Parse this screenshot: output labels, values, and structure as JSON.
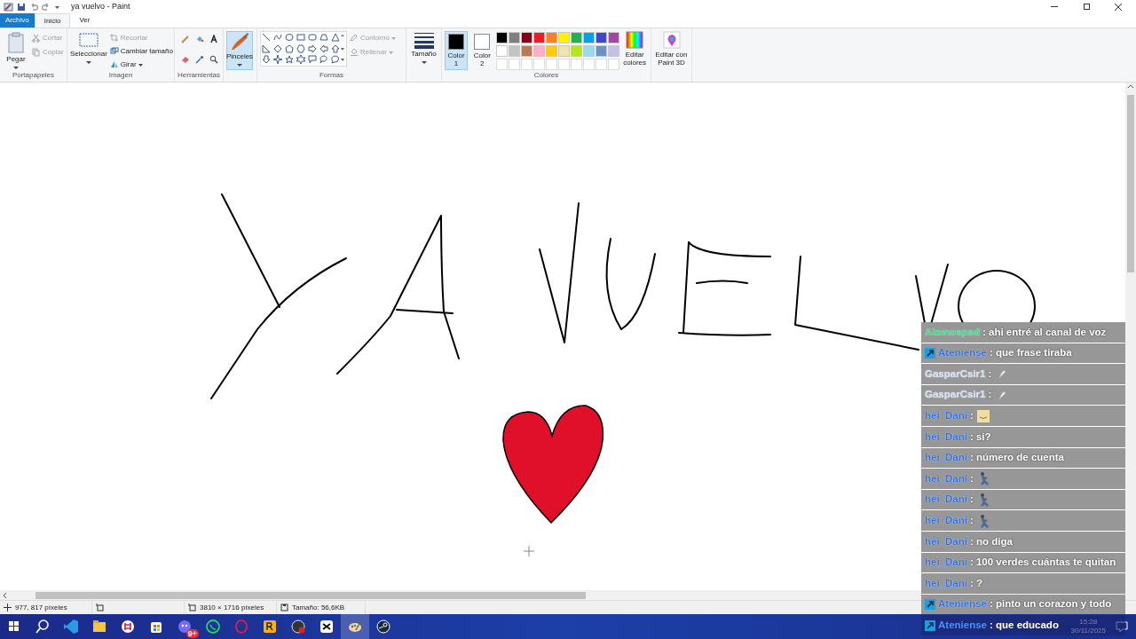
{
  "title_bar": {
    "title": "ya vuelvo - Paint"
  },
  "ribbon_tabs": [
    {
      "label": "Archivo",
      "kind": "file",
      "selected": false
    },
    {
      "label": "Inicio",
      "kind": "tab",
      "selected": true
    },
    {
      "label": "Ver",
      "kind": "tab",
      "selected": false
    }
  ],
  "clipboard": {
    "label": "Portapapeles",
    "paste": "Pegar",
    "items": [
      {
        "label": "Cortar",
        "kind": "cut",
        "disabled": true
      },
      {
        "label": "Copiar",
        "kind": "copy",
        "disabled": true
      }
    ]
  },
  "image": {
    "label": "Imagen",
    "select": "Seleccionar",
    "items": [
      {
        "label": "Recortar",
        "kind": "crop",
        "disabled": true,
        "dropdown": false
      },
      {
        "label": "Cambiar tamaño",
        "kind": "resize",
        "disabled": false,
        "dropdown": false
      },
      {
        "label": "Girar",
        "kind": "rotate",
        "disabled": false,
        "dropdown": true
      }
    ]
  },
  "tools": {
    "label": "Herramientas"
  },
  "brushes": {
    "label": "Pinceles",
    "selected": true
  },
  "shapes": {
    "label": "Formas",
    "items": [
      {
        "label": "Contorno",
        "kind": "outline",
        "disabled": true
      },
      {
        "label": "Rellenar",
        "kind": "fill",
        "disabled": true
      }
    ]
  },
  "size": {
    "label": "Tamaño"
  },
  "colors": {
    "label": "Colores",
    "slots": [
      {
        "label": "Color 1",
        "color": "#000000",
        "selected": true
      },
      {
        "label": "Color 2",
        "color": "#ffffff",
        "selected": false
      }
    ],
    "palette": [
      {
        "kind": "swatch",
        "color": "#000000"
      },
      {
        "kind": "swatch",
        "color": "#7f7f7f"
      },
      {
        "kind": "swatch",
        "color": "#880015"
      },
      {
        "kind": "swatch",
        "color": "#ed1c24"
      },
      {
        "kind": "swatch",
        "color": "#ff7f27"
      },
      {
        "kind": "swatch",
        "color": "#fff200"
      },
      {
        "kind": "swatch",
        "color": "#22b14c"
      },
      {
        "kind": "swatch",
        "color": "#00a2e8"
      },
      {
        "kind": "swatch",
        "color": "#3f48cc"
      },
      {
        "kind": "swatch",
        "color": "#a349a4"
      },
      {
        "kind": "swatch",
        "color": "#ffffff"
      },
      {
        "kind": "swatch",
        "color": "#c3c3c3"
      },
      {
        "kind": "swatch",
        "color": "#b97a57"
      },
      {
        "kind": "swatch",
        "color": "#ffaec9"
      },
      {
        "kind": "swatch",
        "color": "#ffc90e"
      },
      {
        "kind": "swatch",
        "color": "#efe4b0"
      },
      {
        "kind": "swatch",
        "color": "#b5e61d"
      },
      {
        "kind": "swatch",
        "color": "#99d9ea"
      },
      {
        "kind": "swatch",
        "color": "#7092be"
      },
      {
        "kind": "swatch",
        "color": "#c8bfe7"
      },
      {
        "kind": "empty"
      },
      {
        "kind": "empty"
      },
      {
        "kind": "empty"
      },
      {
        "kind": "empty"
      },
      {
        "kind": "empty"
      },
      {
        "kind": "empty"
      },
      {
        "kind": "empty"
      },
      {
        "kind": "empty"
      },
      {
        "kind": "empty"
      },
      {
        "kind": "empty"
      }
    ],
    "edit_colors": "Editar colores"
  },
  "paint3d": {
    "label": "Editar con Paint 3D"
  },
  "chat": [
    {
      "user": "Alemospsd",
      "color": "#3ddc84",
      "badge": false,
      "kind": "text",
      "text": ": ahi entré al canal de voz"
    },
    {
      "user": "Ateniense",
      "color": "#2f6fe0",
      "badge": true,
      "kind": "text",
      "text": ": que frase tiraba"
    },
    {
      "user": "GasparCsir1",
      "color": "#d0dcf0",
      "badge": false,
      "kind": "emote",
      "text": ":"
    },
    {
      "user": "GasparCsir1",
      "color": "#d0dcf0",
      "badge": false,
      "kind": "emote",
      "text": ":"
    },
    {
      "user": "hei_Dani",
      "color": "#2f6fe0",
      "badge": false,
      "kind": "face",
      "text": ":"
    },
    {
      "user": "hei_Dani",
      "color": "#2f6fe0",
      "badge": false,
      "kind": "text",
      "text": ": si?"
    },
    {
      "user": "hei_Dani",
      "color": "#2f6fe0",
      "badge": false,
      "kind": "text",
      "text": ": número de cuenta"
    },
    {
      "user": "hei_Dani",
      "color": "#2f6fe0",
      "badge": false,
      "kind": "runner",
      "text": ":"
    },
    {
      "user": "hei_Dani",
      "color": "#2f6fe0",
      "badge": false,
      "kind": "runner",
      "text": ":"
    },
    {
      "user": "hei_Dani",
      "color": "#2f6fe0",
      "badge": false,
      "kind": "runner",
      "text": ":"
    },
    {
      "user": "hei_Dani",
      "color": "#2f6fe0",
      "badge": false,
      "kind": "text",
      "text": ": no diga"
    },
    {
      "user": "hei_Dani",
      "color": "#2f6fe0",
      "badge": false,
      "kind": "text",
      "text": ": 100 verdes cuántas te quitan"
    },
    {
      "user": "hei_Dani",
      "color": "#2f6fe0",
      "badge": false,
      "kind": "text",
      "text": ": ?"
    },
    {
      "user": "Ateniense",
      "color": "#2f6fe0",
      "badge": true,
      "kind": "text",
      "text": ": pinto un corazon y todo"
    },
    {
      "user": "Ateniense",
      "color": "#4f8ff0",
      "badge": true,
      "kind": "text",
      "text": ": que educado"
    }
  ],
  "status_bar": {
    "cursor": "977, 817 píxeles",
    "canvas_size": "3810 × 1716 píxeles",
    "file_size": "Tamaño: 56,6KB"
  },
  "taskbar": {
    "apps": [
      {
        "kind": "vscode",
        "selected": false
      },
      {
        "kind": "folder",
        "selected": false
      },
      {
        "kind": "slack",
        "selected": false
      },
      {
        "kind": "store",
        "selected": false
      },
      {
        "kind": "discord",
        "selected": false,
        "badge": "9+"
      },
      {
        "kind": "whatsapp",
        "selected": false
      },
      {
        "kind": "opera",
        "selected": false
      },
      {
        "kind": "rockstar",
        "selected": false
      },
      {
        "kind": "recorder",
        "selected": false
      },
      {
        "kind": "capcut",
        "selected": false
      },
      {
        "kind": "paint",
        "selected": true
      },
      {
        "kind": "steam",
        "selected": false
      }
    ],
    "time": "15:28",
    "date": "30/11/2025"
  }
}
